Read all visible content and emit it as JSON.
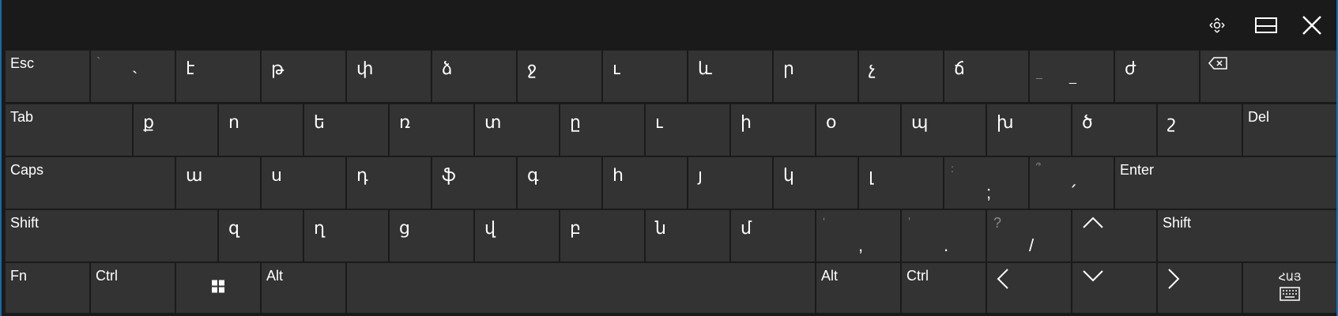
{
  "titlebar": {
    "icons": [
      "move-icon",
      "dock-icon",
      "close-icon"
    ]
  },
  "rows": {
    "row1": {
      "esc": "Esc",
      "k1": {
        "shift": "՝",
        "base": "`"
      },
      "k2": "է",
      "k3": "թ",
      "k4": "փ",
      "k5": "ձ",
      "k6": "ջ",
      "k7": "ւ",
      "k8": "և",
      "k9": "ր",
      "k10": "չ",
      "k11": "ճ",
      "k12": {
        "shift": "_",
        "base": "_"
      },
      "k13": "ժ",
      "backspace_icon": "backspace-icon"
    },
    "row2": {
      "tab": "Tab",
      "keys": [
        "ք",
        "ո",
        "ե",
        "ռ",
        "տ",
        "ը",
        "ւ",
        "ի",
        "օ",
        "պ",
        "խ",
        "ծ",
        "շ"
      ],
      "del": "Del"
    },
    "row3": {
      "caps": "Caps",
      "keys": [
        "ա",
        "ս",
        "դ",
        "ֆ",
        "գ",
        "հ",
        "յ",
        "կ",
        "լ"
      ],
      "semi": {
        "shift": ":",
        "base": ";"
      },
      "quote": {
        "shift": "՞",
        "base": "՛"
      },
      "enter": "Enter"
    },
    "row4": {
      "shift_left": "Shift",
      "keys": [
        "զ",
        "ղ",
        "ց",
        "վ",
        "բ",
        "ն",
        "մ"
      ],
      "comma": {
        "shift": "‘",
        "base": ","
      },
      "period": {
        "shift": "’",
        "base": "."
      },
      "slash": {
        "shift": "?",
        "base": "/"
      },
      "shift_right": "Shift"
    },
    "row5": {
      "fn": "Fn",
      "ctrl_left": "Ctrl",
      "alt_left": "Alt",
      "alt_right": "Alt",
      "ctrl_right": "Ctrl",
      "lang": "ՀԱՅ"
    }
  }
}
